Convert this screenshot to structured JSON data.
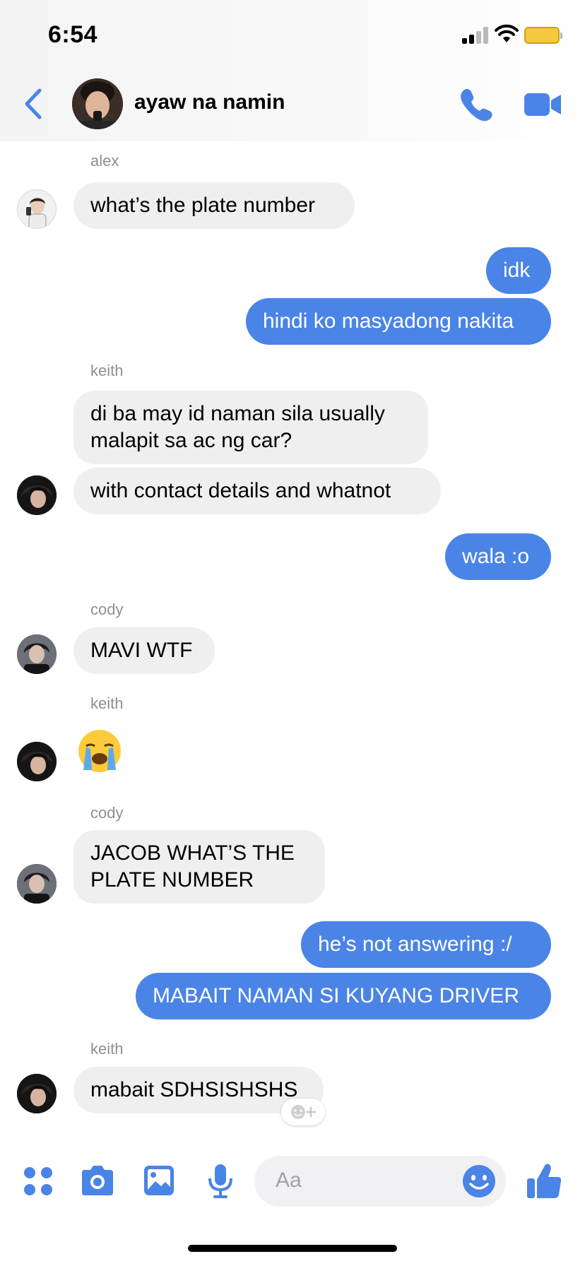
{
  "status_bar": {
    "time": "6:54"
  },
  "header": {
    "title": "ayaw na namin"
  },
  "messages": [
    {
      "sender": "alex"
    },
    {
      "text": "what’s the plate number"
    },
    {
      "text": "idk"
    },
    {
      "text": "hindi ko masyadong nakita"
    },
    {
      "sender": "keith"
    },
    {
      "text": "di ba may id naman sila usually malapit sa ac ng car?"
    },
    {
      "text": "with contact details and whatnot"
    },
    {
      "text": "wala :o"
    },
    {
      "sender": "cody"
    },
    {
      "text": "MAVI WTF"
    },
    {
      "sender": "keith"
    },
    {
      "emoji": "😭"
    },
    {
      "sender": "cody"
    },
    {
      "text": "JACOB WHAT’S THE PLATE NUMBER"
    },
    {
      "text": "he’s not answering :/"
    },
    {
      "text": "MABAIT NAMAN SI KUYANG DRIVER"
    },
    {
      "sender": "keith"
    },
    {
      "text": "mabait SDHSISHSHS"
    }
  ],
  "composer": {
    "placeholder": "Aa"
  },
  "colors": {
    "accent": "#4a84e6",
    "incoming_bubble": "#efefef"
  },
  "icons": [
    "back-chevron-icon",
    "phone-icon",
    "video-camera-icon",
    "apps-grid-icon",
    "camera-icon",
    "gallery-icon",
    "microphone-icon",
    "emoji-icon",
    "thumbs-up-icon",
    "add-reaction-icon"
  ]
}
